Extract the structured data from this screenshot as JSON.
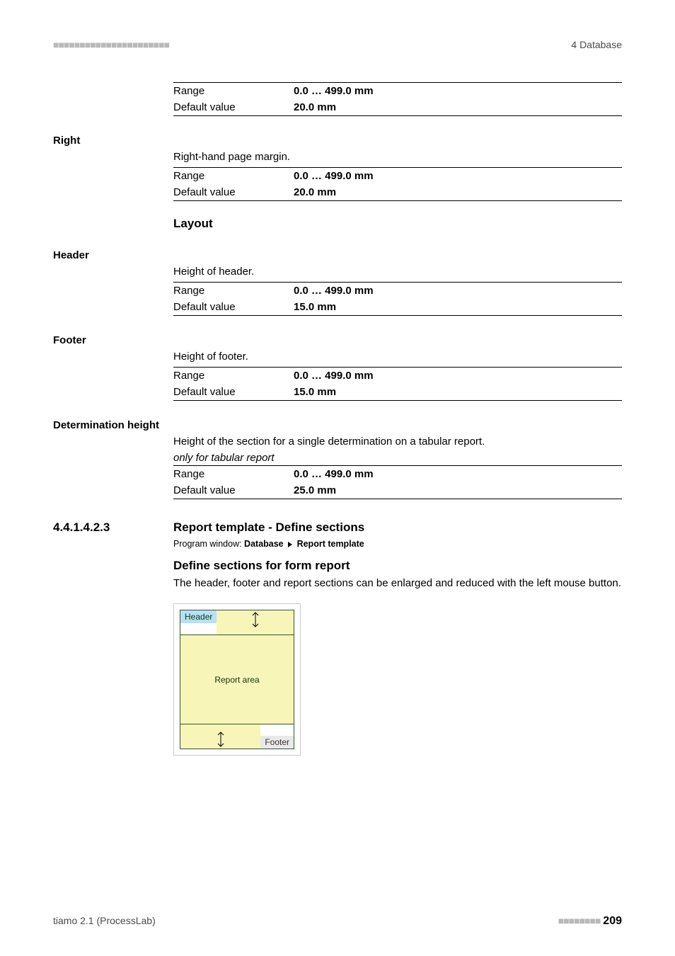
{
  "running": {
    "left_dots": "■■■■■■■■■■■■■■■■■■■■■■",
    "right": "4 Database"
  },
  "top_table": {
    "range_k": "Range",
    "range_v": "0.0 … 499.0 mm",
    "def_k": "Default value",
    "def_v": "20.0 mm"
  },
  "right": {
    "label": "Right",
    "desc": "Right-hand page margin.",
    "range_k": "Range",
    "range_v": "0.0 … 499.0 mm",
    "def_k": "Default value",
    "def_v": "20.0 mm"
  },
  "layout_head": "Layout",
  "header": {
    "label": "Header",
    "desc": "Height of header.",
    "range_k": "Range",
    "range_v": "0.0 … 499.0 mm",
    "def_k": "Default value",
    "def_v": "15.0 mm"
  },
  "footer": {
    "label": "Footer",
    "desc": "Height of footer.",
    "range_k": "Range",
    "range_v": "0.0 … 499.0 mm",
    "def_k": "Default value",
    "def_v": "15.0 mm"
  },
  "det": {
    "label": "Determination height",
    "desc": "Height of the section for a single determination on a tabular report.",
    "note": "only for tabular report",
    "range_k": "Range",
    "range_v": "0.0 … 499.0 mm",
    "def_k": "Default value",
    "def_v": "25.0 mm"
  },
  "section": {
    "num": "4.4.1.4.2.3",
    "title": "Report template - Define sections",
    "note_a": "Program window: ",
    "note_b": "Database ",
    "note_c": " Report template",
    "subhead": "Define sections for form report",
    "para": "The header, footer and report sections can be enlarged and reduced with the left mouse button."
  },
  "fig": {
    "header": "Header",
    "area": "Report area",
    "footer": "Footer"
  },
  "pagefoot": {
    "left": "tiamo 2.1 (ProcessLab)",
    "dots": "■■■■■■■■",
    "num": "209"
  }
}
